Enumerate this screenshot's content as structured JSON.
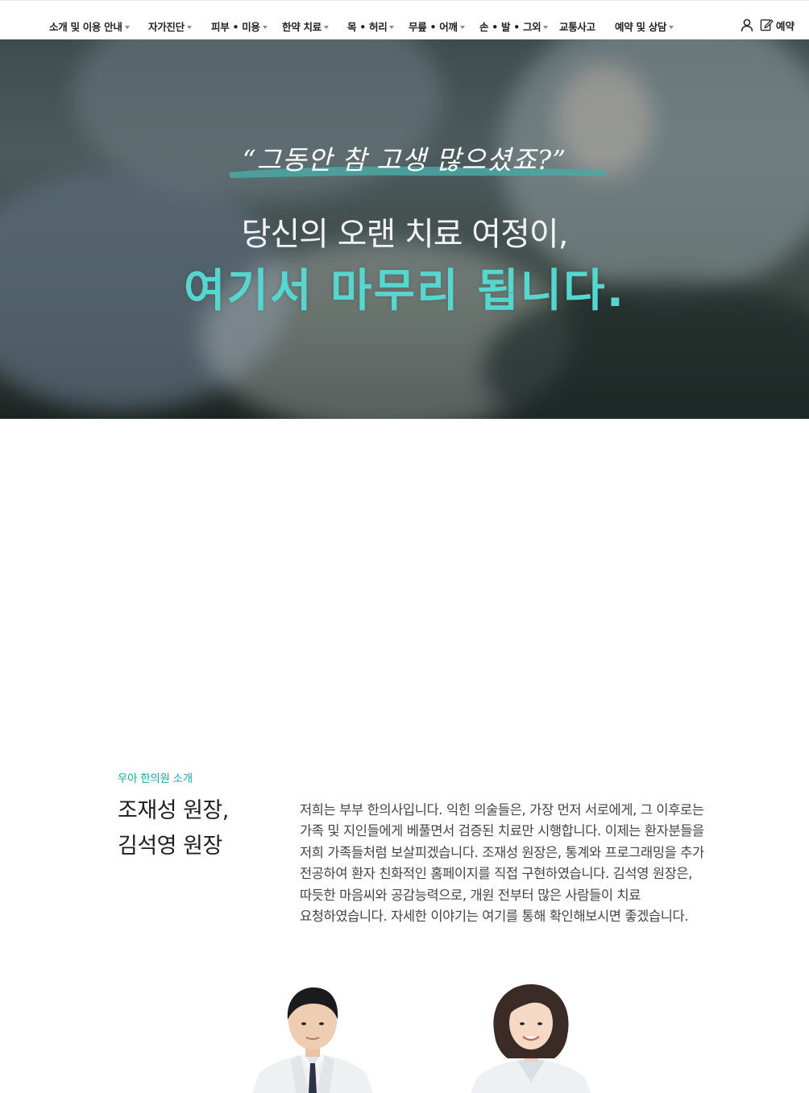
{
  "nav": {
    "items": [
      {
        "label": "소개 및 이용 안내",
        "has_dropdown": true
      },
      {
        "label": "자가진단",
        "has_dropdown": true
      },
      {
        "label": "피부 • 미용",
        "has_dropdown": true
      },
      {
        "label": "한약 치료",
        "has_dropdown": true
      },
      {
        "label": "목 • 허리",
        "has_dropdown": true
      },
      {
        "label": "무릎 • 어깨",
        "has_dropdown": true
      },
      {
        "label": "손 • 발 • 그외",
        "has_dropdown": true
      },
      {
        "label": "교통사고",
        "has_dropdown": false
      },
      {
        "label": "예약 및 상담",
        "has_dropdown": true
      }
    ],
    "user_icon": "user-icon",
    "reserve_icon": "edit-icon",
    "reserve_label": "예약"
  },
  "hero": {
    "quote": "“그동안 참 고생 많으셨죠?”",
    "line1": "당신의 오랜 치료 여정이,",
    "line2": "여기서 마무리 됩니다.",
    "accent_color": "#55d6cf"
  },
  "intro": {
    "kicker": "우아 한의원 소개",
    "name_line1": "조재성 원장,",
    "name_line2": "김석영 원장",
    "body": "저희는 부부 한의사입니다. 익힌 의술들은, 가장 먼저 서로에게, 그 이후로는 가족 및 지인들에게 베풀면서 검증된 치료만 시행합니다. 이제는 환자분들을 저희 가족들처럼 보살피겠습니다. 조재성 원장은, 통계와 프로그래밍을 추가 전공하여 환자 친화적인 홈페이지를 직접 구현하였습니다. 김석영 원장은, 따듯한 마음씨와 공감능력으로, 개원 전부터 많은 사람들이 치료 요청하였습니다. 자세한 이야기는 여기를 통해 확인해보시면 좋겠습니다.",
    "accent_color": "#1fa7a0"
  }
}
